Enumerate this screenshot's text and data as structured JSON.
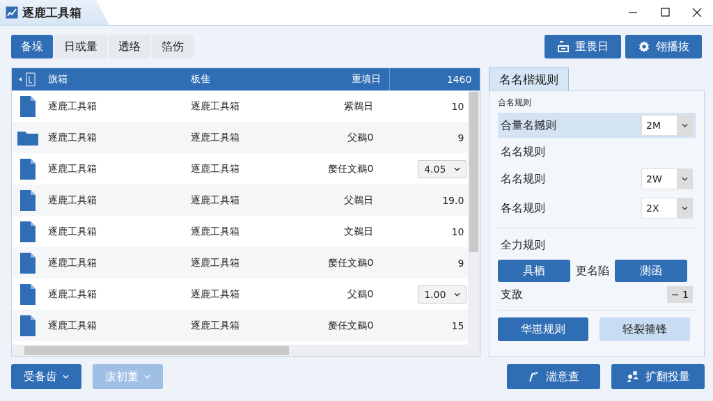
{
  "window": {
    "title": "逐鹿工具箱"
  },
  "tabs": [
    {
      "label": "备垛",
      "selected": true
    },
    {
      "label": "日或量",
      "selected": false
    },
    {
      "label": "透络",
      "selected": false
    },
    {
      "label": "箔伤",
      "selected": false
    }
  ],
  "toolbar_buttons": [
    {
      "label": "重畏日",
      "kind": "plus"
    },
    {
      "label": "翎播抜",
      "kind": "gear"
    }
  ],
  "table": {
    "columns": [
      "旗箱",
      "板隹",
      "重填日",
      "1460"
    ],
    "rows": [
      {
        "kind": "file",
        "name": "逐鹿工具箱",
        "column_2": "逐鹿工具箱",
        "date": "紫鵜日",
        "value": "10"
      },
      {
        "kind": "folder",
        "name": "逐鹿工具箱",
        "column_2": "逐鹿工具箱",
        "date": "父鵜0",
        "value": "9"
      },
      {
        "kind": "file",
        "name": "逐鹿工具箱",
        "column_2": "逐鹿工具箱",
        "date": "嫠任文鵜0",
        "select": "4.05"
      },
      {
        "kind": "file",
        "name": "逐鹿工具箱",
        "column_2": "逐鹿工具箱",
        "date": "父鵜日",
        "value": "19.0"
      },
      {
        "kind": "file",
        "name": "逐鹿工具箱",
        "column_2": "逐鹿工具箱",
        "date": "文鵜日",
        "value": "10"
      },
      {
        "kind": "file",
        "name": "逐鹿工具箱",
        "column_2": "逐鹿工具箱",
        "date": "嫠任文鵜0",
        "value": "9"
      },
      {
        "kind": "file",
        "name": "逐鹿工具箱",
        "column_2": "逐鹿工具箱",
        "date": "父鵜0",
        "select": "1.00"
      },
      {
        "kind": "file",
        "name": "逐鹿工具箱",
        "column_2": "逐鹿工具箱",
        "date": "嫠任文鵜0",
        "value": "15"
      }
    ]
  },
  "panel": {
    "tab": "名名楷规则",
    "section": "合名规则",
    "fields": [
      {
        "label": "合量名撼则",
        "value": "2M",
        "selected": true
      }
    ],
    "heading": "名名规则",
    "fields_2": [
      {
        "label": "名名规则",
        "value": "2W",
        "selected": false
      },
      {
        "label": "各名规则",
        "value": "2X",
        "selected": false
      }
    ],
    "heading_2": "全力规则",
    "button_left": "具栖",
    "middle_text": "更名陷",
    "button_right": "测函",
    "stepper": {
      "label": "支敌",
      "value": "− 1"
    },
    "actions": [
      {
        "label": "华崽规则",
        "kind": "primary"
      },
      {
        "label": "轻裂箍锋",
        "kind": "light"
      }
    ]
  },
  "bottom_left": [
    {
      "label": "受备齿",
      "disabled": false
    },
    {
      "label": "泼初董",
      "disabled": true
    }
  ],
  "bottom_right": [
    {
      "label": "湍意查",
      "kind": "pen"
    },
    {
      "label": "扩翻投量",
      "kind": "people"
    }
  ]
}
